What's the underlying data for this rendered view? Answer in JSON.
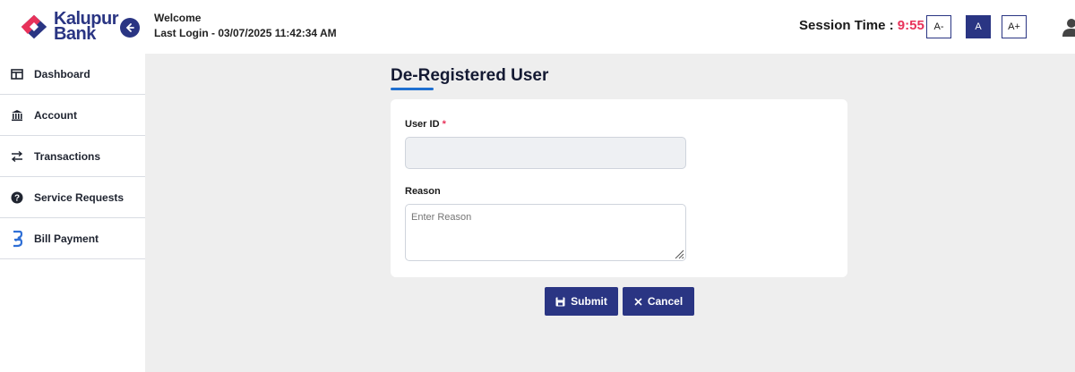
{
  "brand": {
    "name_line1": "Kalupur",
    "name_line2": "Bank",
    "color_primary": "#2a3583",
    "color_accent": "#e8325a"
  },
  "header": {
    "welcome": "Welcome",
    "last_login": "Last Login - 03/07/2025 11:42:34 AM",
    "session_label": "Session Time : ",
    "session_time": "9:55",
    "font_buttons": [
      "A-",
      "A",
      "A+"
    ]
  },
  "sidebar": {
    "items": [
      {
        "label": "Dashboard",
        "icon": "dashboard-icon"
      },
      {
        "label": "Account",
        "icon": "bank-icon"
      },
      {
        "label": "Transactions",
        "icon": "transfer-icon"
      },
      {
        "label": "Service Requests",
        "icon": "help-icon"
      },
      {
        "label": "Bill Payment",
        "icon": "bill-payment-icon"
      }
    ]
  },
  "form": {
    "title": "De-Registered User",
    "user_id_label": "User ID",
    "required_mark": "*",
    "user_id_value": "",
    "reason_label": "Reason",
    "reason_placeholder": "Enter Reason",
    "submit_label": "Submit",
    "cancel_label": "Cancel"
  }
}
